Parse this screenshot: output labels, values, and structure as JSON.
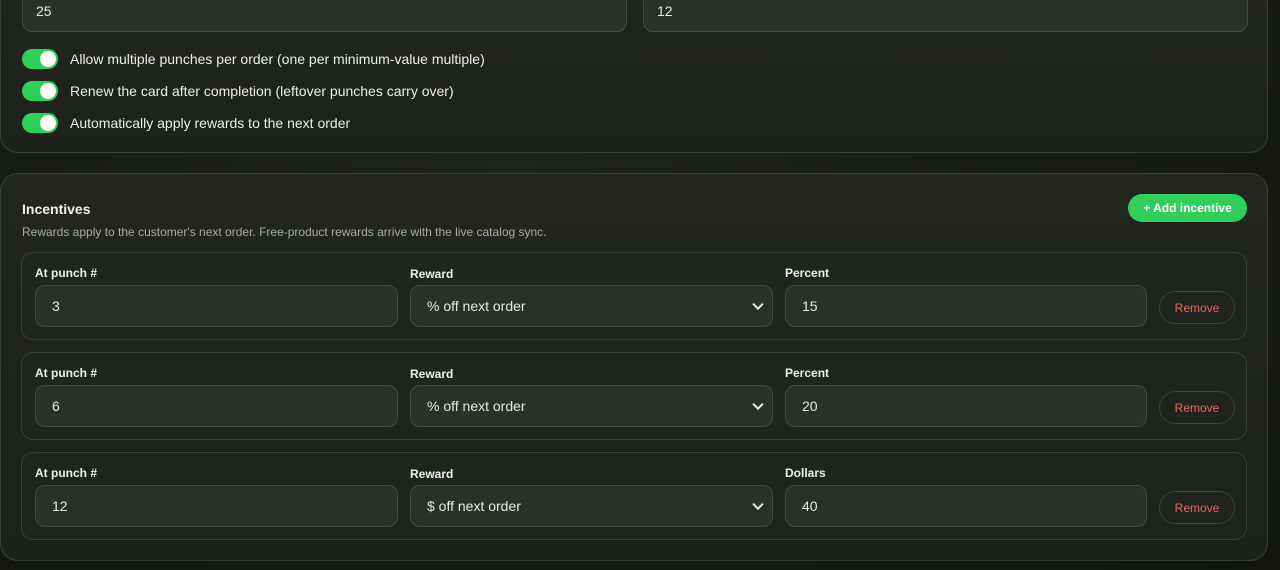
{
  "settings": {
    "field_left_value": "25",
    "field_right_value": "12",
    "toggles": [
      {
        "label": "Allow multiple punches per order (one per minimum-value multiple)",
        "on": true
      },
      {
        "label": "Renew the card after completion (leftover punches carry over)",
        "on": true
      },
      {
        "label": "Automatically apply rewards to the next order",
        "on": true
      }
    ]
  },
  "incentives": {
    "title": "Incentives",
    "subtitle": "Rewards apply to the customer's next order. Free-product rewards arrive with the live catalog sync.",
    "add_label": "+ Add incentive",
    "punch_label": "At punch #",
    "reward_label": "Reward",
    "remove_label": "Remove",
    "rows": [
      {
        "punch": "3",
        "reward": "% off next order",
        "value_label": "Percent",
        "value": "15"
      },
      {
        "punch": "6",
        "reward": "% off next order",
        "value_label": "Percent",
        "value": "20"
      },
      {
        "punch": "12",
        "reward": "$ off next order",
        "value_label": "Dollars",
        "value": "40"
      }
    ]
  },
  "colors": {
    "accent": "#2fcf5a",
    "danger": "#e5695f"
  }
}
